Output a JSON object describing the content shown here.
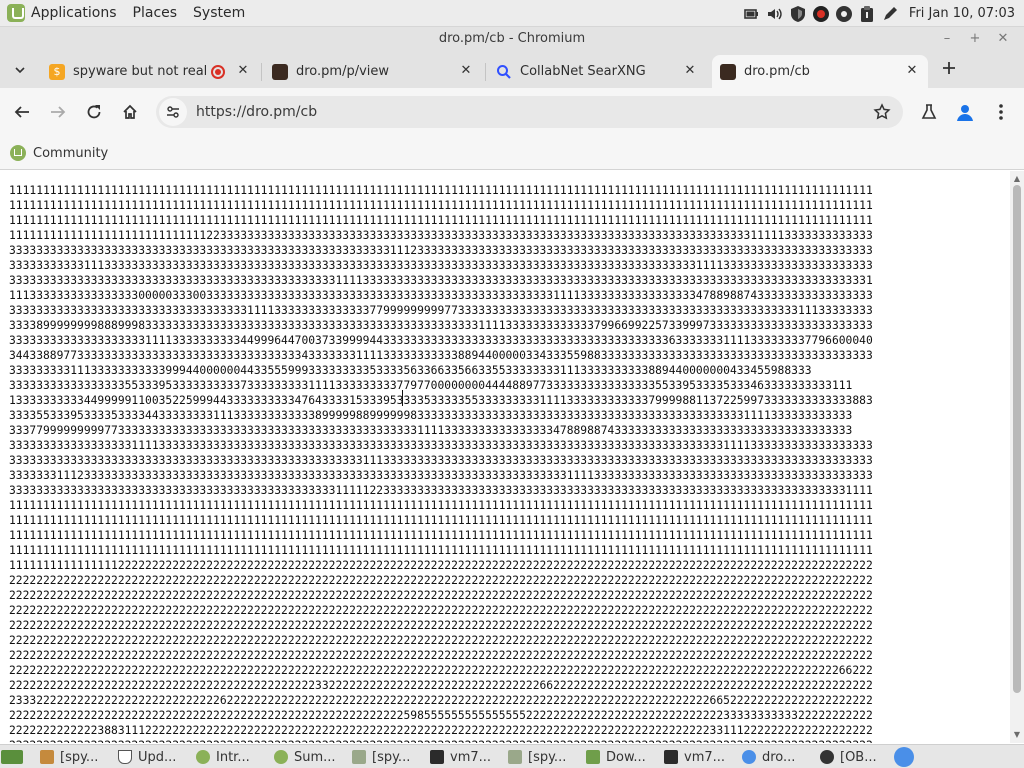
{
  "top_panel": {
    "menus": [
      "Applications",
      "Places",
      "System"
    ],
    "clock": "Fri Jan 10, 07:03",
    "tray_icons": [
      "battery-icon",
      "volume-icon",
      "shield-icon",
      "record-icon",
      "clipboard-icon",
      "pen-icon"
    ]
  },
  "window": {
    "title": "dro.pm/cb - Chromium"
  },
  "tabs": [
    {
      "title": "spyware but not really",
      "icon": "s-favicon",
      "recording": true
    },
    {
      "title": "dro.pm/p/view",
      "icon": "dro-favicon"
    },
    {
      "title": "CollabNet SearXNG",
      "icon": "search-favicon"
    },
    {
      "title": "dro.pm/cb",
      "icon": "dro-favicon",
      "active": true
    }
  ],
  "toolbar": {
    "url": "https://dro.pm/cb"
  },
  "bookmarks": [
    {
      "label": "Community"
    }
  ],
  "content": {
    "text": "1111111111111111111111111111111111111111111111111111111111111111111111111111111111111111111111111111111111111111111111111111111\n1111111111111111111111111111111111111111111111111111111111111111111111111111111111111111111111111111111111111111111111111111111\n1111111111111111111111111111111111111111111111111111111111111111111111111111111111111111111111111111111111111111111111111111111\n1111111111111111111111111111122333333333333333333333333333333333333333333333333333333333333333333333333333333111113333333333333\n3333333333333333333333333333333333333333333333333333333311123333333333333333333333333333333333333333333333333333333333333333333\n3333333333311133333333333333333333333333333333333333333333333333333333333333333333333333333333333333311113333333333333333333333\n3333333333333333333333333333333333333333333333331111333333333333333333333333333333333333333333333333333333333333333333333333331\n1113333333333333333000003330033333333333333333333333333333333333333333333333333311113333333333333333347889887433333333333333333\n3333333333333333333333333333333333311113333333333333377999999999773333333333333333333333333333333333333333333333333311133333333\n3333899999999888999833333333333333333333333333333333333333333333333331111333333333333379966992257339997333333333333333333333333\n3333333333333333333311113333333333449996447003733999944333333333333333333333333333333333333333333633333331111333333337796600040\n3443388977333333333333333333333333333333333433333331111333333333338894400000334333559883333333333333333333333333333333333333333\n3333333331113333333333399944000000443355599933333333353333563366335663355333333331113333333333889440000000433455988333\n3333333333333333355333953333333333733333333311113333333337797700000000444488977333333333333333355339533335333463333333333111\n1333333333344999991100352259994433333333334764333315333953333533333553333333331111333333333333799998811372259973333333333333883\n3333553339533335333344333333331113333333333338999998899999983333333333333333333333333333333333333333333333331111333333333333\n3337799999999977333333333333333333333333333333333333333333331111333333333333333347889887433333333333333333333333333333333333\n3333333333333333331111333333333333333333333333333333333333333333333333333333333333333333333333333333333331111333333333333333333\n3333333333333333333333333333333333333333333333333333111333333333333333333333333333333333333333333333333333333333333333333333333\n3333333111233333333333333333333333333333333333333333333333333333333333333333333333111133333333333333333333333333333333333333333\n3333333333333333333333333333333333333333333333331111122333333333333333333333333333333333333333333333333333333333333333333331111\n1111111111111111111111111111111111111111111111111111111111111111111111111111111111111111111111111111111111111111111111111111111\n1111111111111111111111111111111111111111111111111111111111111111111111111111111111111111111111111111111111111111111111111111111\n1111111111111111111111111111111111111111111111111111111111111111111111111111111111111111111111111111111111111111111111111111111\n1111111111111111111111111111111111111111111111111111111111111111111111111111111111111111111111111111111111111111111111111111111\n1111111111111111222222222222222222222222222222222222222222222222222222222222222222222222222222222222222222222222222222222222222\n2222222222222222222222222222222222222222222222222222222222222222222222222222222222222222222222222222222222222222222222222222222\n2222222222222222222222222222222222222222222222222222222222222222222222222222222222222222222222222222222222222222222222222222222\n2222222222222222222222222222222222222222222222222222222222222222222222222222222222222222222222222222222222222222222222222222222\n2222222222222222222222222222222222222222222222222222222222222222222222222222222222222222222222222222222222222222222222222222222\n2222222222222222222222222222222222222222222222222222222222222222222222222222222222222222222222222222222222222222222222222222222\n2222222222222222222222222222222222222222222222222222222222222222222222222222222222222222222222222222222222222222222222222222222\n2222222222222222222222222222222222222222222222222222222222222222222222222222222222222222222222222222222222222222222222222266222\n2222222222222222222222222222222222222222222223322222222222222222222222222222226622222222222222222222222222222222222222222222222\n2333222222222222222222222222222622222222222222222222222222222222222222222222222222222222222222222222222665222222222222222222222\n2222222222222222222222222222222222222222222222222222222222598555555555555555222222222222222222222222222223333333333322222222222\n2222222222222388311122222222222222222222222222222222222222222222222222222222222222222222222222222222222331112222222222222222222\n2222222222222222222222222222222222222222222222222222222222222222222222222222222222222222222222222222222222222222222222222222222"
  },
  "taskbar": {
    "items": [
      {
        "label": "[spy...",
        "icon": "folder-icon"
      },
      {
        "label": "Upd...",
        "icon": "shield-icon"
      },
      {
        "label": "Intr...",
        "icon": "mint-icon"
      },
      {
        "label": "Sum...",
        "icon": "mint-icon"
      },
      {
        "label": "[spy...",
        "icon": "doc-icon"
      },
      {
        "label": "vm7...",
        "icon": "terminal-icon"
      },
      {
        "label": "[spy...",
        "icon": "doc-icon"
      },
      {
        "label": "Dow...",
        "icon": "folder-icon"
      },
      {
        "label": "vm7...",
        "icon": "terminal-icon"
      },
      {
        "label": "dro...",
        "icon": "chromium-icon"
      },
      {
        "label": "[OB...",
        "icon": "obs-icon"
      }
    ]
  },
  "colors": {
    "accent": "#1a73e8",
    "mint": "#8bb158",
    "record": "#d93025"
  }
}
